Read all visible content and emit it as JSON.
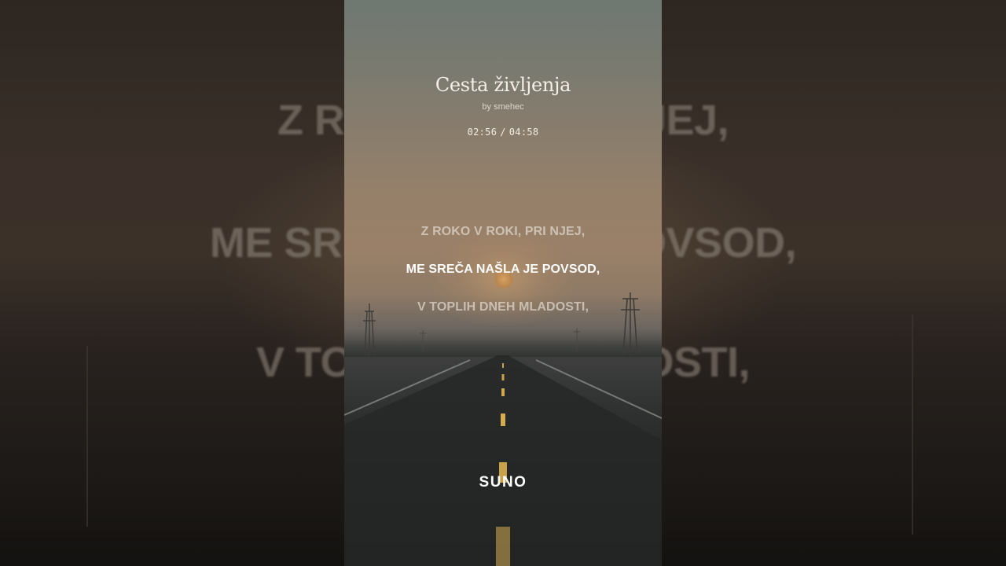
{
  "song": {
    "title": "Cesta življenja",
    "artist": "by smehec"
  },
  "playback": {
    "current_time": "02:56",
    "separator": "/",
    "total_time": "04:58"
  },
  "lyrics": {
    "previous": "Z ROKO V ROKI, PRI NJEJ,",
    "current": "ME SREČA NAŠLA JE POVSOD,",
    "next": "V TOPLIH DNEH MLADOSTI,"
  },
  "background_lyrics": {
    "line1": "Z ROK                  NJEJ,",
    "line2": "ME SREČ                  POVSOD,",
    "line3": "V TOPL                  DOSTI,"
  },
  "brand": {
    "logo_text": "SUNO"
  },
  "colors": {
    "lyric_active": "#ffffff",
    "lyric_dim": "#e1dad0",
    "title": "#f3eee7"
  }
}
